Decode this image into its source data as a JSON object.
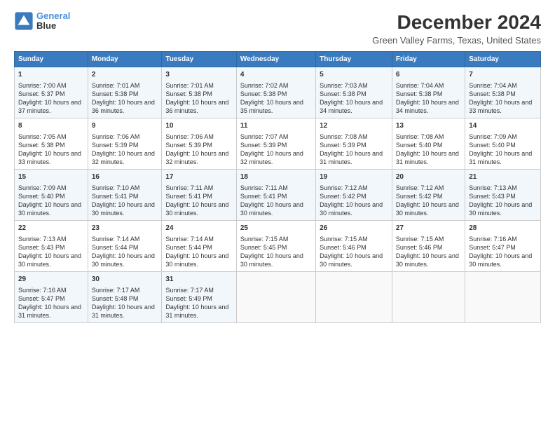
{
  "header": {
    "title": "December 2024",
    "subtitle": "Green Valley Farms, Texas, United States"
  },
  "columns": [
    "Sunday",
    "Monday",
    "Tuesday",
    "Wednesday",
    "Thursday",
    "Friday",
    "Saturday"
  ],
  "weeks": [
    [
      {
        "day": "1",
        "rise": "Sunrise: 7:00 AM",
        "set": "Sunset: 5:37 PM",
        "light": "Daylight: 10 hours and 37 minutes."
      },
      {
        "day": "2",
        "rise": "Sunrise: 7:01 AM",
        "set": "Sunset: 5:38 PM",
        "light": "Daylight: 10 hours and 36 minutes."
      },
      {
        "day": "3",
        "rise": "Sunrise: 7:01 AM",
        "set": "Sunset: 5:38 PM",
        "light": "Daylight: 10 hours and 36 minutes."
      },
      {
        "day": "4",
        "rise": "Sunrise: 7:02 AM",
        "set": "Sunset: 5:38 PM",
        "light": "Daylight: 10 hours and 35 minutes."
      },
      {
        "day": "5",
        "rise": "Sunrise: 7:03 AM",
        "set": "Sunset: 5:38 PM",
        "light": "Daylight: 10 hours and 34 minutes."
      },
      {
        "day": "6",
        "rise": "Sunrise: 7:04 AM",
        "set": "Sunset: 5:38 PM",
        "light": "Daylight: 10 hours and 34 minutes."
      },
      {
        "day": "7",
        "rise": "Sunrise: 7:04 AM",
        "set": "Sunset: 5:38 PM",
        "light": "Daylight: 10 hours and 33 minutes."
      }
    ],
    [
      {
        "day": "8",
        "rise": "Sunrise: 7:05 AM",
        "set": "Sunset: 5:38 PM",
        "light": "Daylight: 10 hours and 33 minutes."
      },
      {
        "day": "9",
        "rise": "Sunrise: 7:06 AM",
        "set": "Sunset: 5:39 PM",
        "light": "Daylight: 10 hours and 32 minutes."
      },
      {
        "day": "10",
        "rise": "Sunrise: 7:06 AM",
        "set": "Sunset: 5:39 PM",
        "light": "Daylight: 10 hours and 32 minutes."
      },
      {
        "day": "11",
        "rise": "Sunrise: 7:07 AM",
        "set": "Sunset: 5:39 PM",
        "light": "Daylight: 10 hours and 32 minutes."
      },
      {
        "day": "12",
        "rise": "Sunrise: 7:08 AM",
        "set": "Sunset: 5:39 PM",
        "light": "Daylight: 10 hours and 31 minutes."
      },
      {
        "day": "13",
        "rise": "Sunrise: 7:08 AM",
        "set": "Sunset: 5:40 PM",
        "light": "Daylight: 10 hours and 31 minutes."
      },
      {
        "day": "14",
        "rise": "Sunrise: 7:09 AM",
        "set": "Sunset: 5:40 PM",
        "light": "Daylight: 10 hours and 31 minutes."
      }
    ],
    [
      {
        "day": "15",
        "rise": "Sunrise: 7:09 AM",
        "set": "Sunset: 5:40 PM",
        "light": "Daylight: 10 hours and 30 minutes."
      },
      {
        "day": "16",
        "rise": "Sunrise: 7:10 AM",
        "set": "Sunset: 5:41 PM",
        "light": "Daylight: 10 hours and 30 minutes."
      },
      {
        "day": "17",
        "rise": "Sunrise: 7:11 AM",
        "set": "Sunset: 5:41 PM",
        "light": "Daylight: 10 hours and 30 minutes."
      },
      {
        "day": "18",
        "rise": "Sunrise: 7:11 AM",
        "set": "Sunset: 5:41 PM",
        "light": "Daylight: 10 hours and 30 minutes."
      },
      {
        "day": "19",
        "rise": "Sunrise: 7:12 AM",
        "set": "Sunset: 5:42 PM",
        "light": "Daylight: 10 hours and 30 minutes."
      },
      {
        "day": "20",
        "rise": "Sunrise: 7:12 AM",
        "set": "Sunset: 5:42 PM",
        "light": "Daylight: 10 hours and 30 minutes."
      },
      {
        "day": "21",
        "rise": "Sunrise: 7:13 AM",
        "set": "Sunset: 5:43 PM",
        "light": "Daylight: 10 hours and 30 minutes."
      }
    ],
    [
      {
        "day": "22",
        "rise": "Sunrise: 7:13 AM",
        "set": "Sunset: 5:43 PM",
        "light": "Daylight: 10 hours and 30 minutes."
      },
      {
        "day": "23",
        "rise": "Sunrise: 7:14 AM",
        "set": "Sunset: 5:44 PM",
        "light": "Daylight: 10 hours and 30 minutes."
      },
      {
        "day": "24",
        "rise": "Sunrise: 7:14 AM",
        "set": "Sunset: 5:44 PM",
        "light": "Daylight: 10 hours and 30 minutes."
      },
      {
        "day": "25",
        "rise": "Sunrise: 7:15 AM",
        "set": "Sunset: 5:45 PM",
        "light": "Daylight: 10 hours and 30 minutes."
      },
      {
        "day": "26",
        "rise": "Sunrise: 7:15 AM",
        "set": "Sunset: 5:46 PM",
        "light": "Daylight: 10 hours and 30 minutes."
      },
      {
        "day": "27",
        "rise": "Sunrise: 7:15 AM",
        "set": "Sunset: 5:46 PM",
        "light": "Daylight: 10 hours and 30 minutes."
      },
      {
        "day": "28",
        "rise": "Sunrise: 7:16 AM",
        "set": "Sunset: 5:47 PM",
        "light": "Daylight: 10 hours and 30 minutes."
      }
    ],
    [
      {
        "day": "29",
        "rise": "Sunrise: 7:16 AM",
        "set": "Sunset: 5:47 PM",
        "light": "Daylight: 10 hours and 31 minutes."
      },
      {
        "day": "30",
        "rise": "Sunrise: 7:17 AM",
        "set": "Sunset: 5:48 PM",
        "light": "Daylight: 10 hours and 31 minutes."
      },
      {
        "day": "31",
        "rise": "Sunrise: 7:17 AM",
        "set": "Sunset: 5:49 PM",
        "light": "Daylight: 10 hours and 31 minutes."
      },
      null,
      null,
      null,
      null
    ]
  ]
}
